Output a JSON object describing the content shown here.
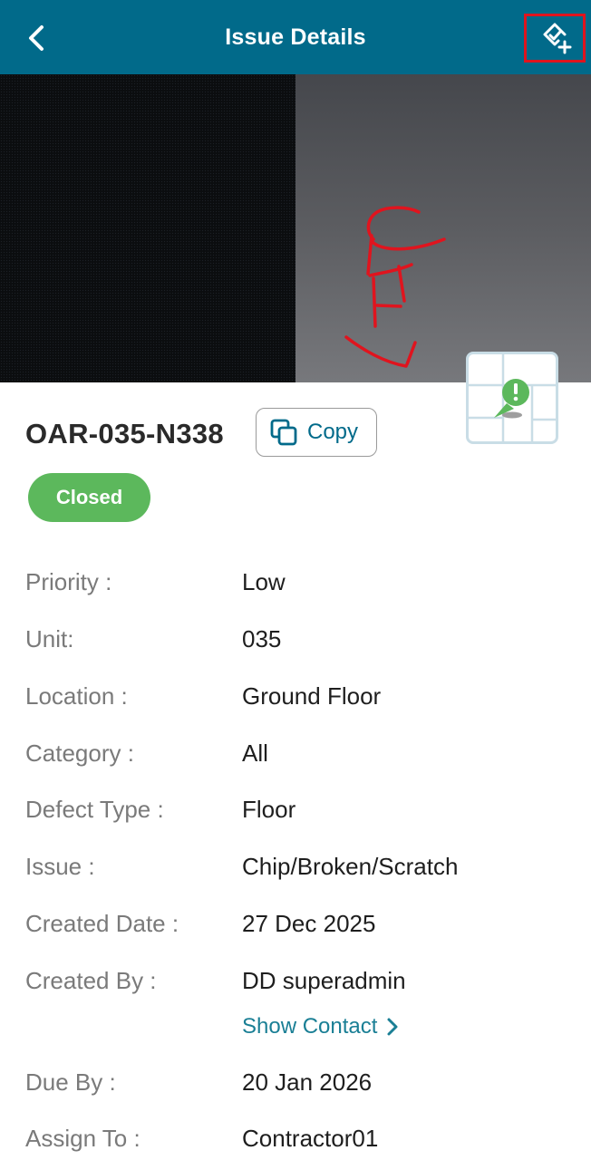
{
  "header": {
    "title": "Issue Details",
    "back_icon": "chevron-left-icon",
    "action_icon": "add-task-icon",
    "background": "#016A8A",
    "highlight_color": "#E0141E"
  },
  "issue": {
    "code": "OAR-035-N338",
    "copy_label": "Copy",
    "status": "Closed",
    "status_color": "#5CB85C"
  },
  "details": [
    {
      "label": "Priority :",
      "value": "Low"
    },
    {
      "label": "Unit:",
      "value": "035"
    },
    {
      "label": "Location :",
      "value": "Ground Floor"
    },
    {
      "label": "Category :",
      "value": "All"
    },
    {
      "label": "Defect Type :",
      "value": "Floor"
    },
    {
      "label": "Issue :",
      "value": "Chip/Broken/Scratch"
    },
    {
      "label": "Created Date :",
      "value": "27 Dec 2025"
    },
    {
      "label": "Created By :",
      "value": "DD superadmin"
    },
    {
      "label": "Due By :",
      "value": "20 Jan 2026"
    },
    {
      "label": "Assign To :",
      "value": "Contractor01"
    }
  ],
  "show_contact": {
    "label": "Show Contact",
    "icon": "chevron-right-icon"
  },
  "accent_color": "#1a7f95"
}
